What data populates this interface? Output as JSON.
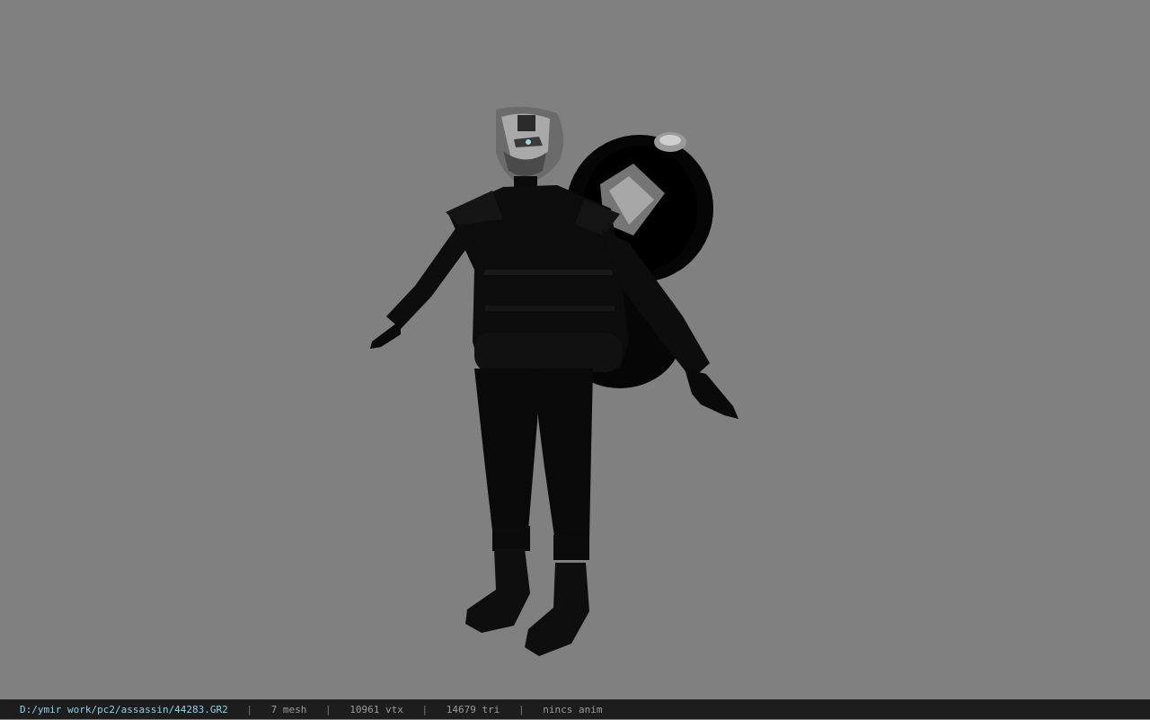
{
  "viewport": {
    "background": "#808080",
    "model": {
      "icon": "character-model-icon",
      "body_color": "#0a0a0a",
      "texture_color": "#b8b8b8"
    }
  },
  "statusbar": {
    "file_path": "D:/ymir work/pc2/assassin/44283.GR2",
    "separator": "|",
    "mesh_count": "7 mesh",
    "vertex_count": "10961 vtx",
    "triangle_count": "14679 tri",
    "anim_status": "nincs anim",
    "path_color": "#8fd0e8"
  }
}
